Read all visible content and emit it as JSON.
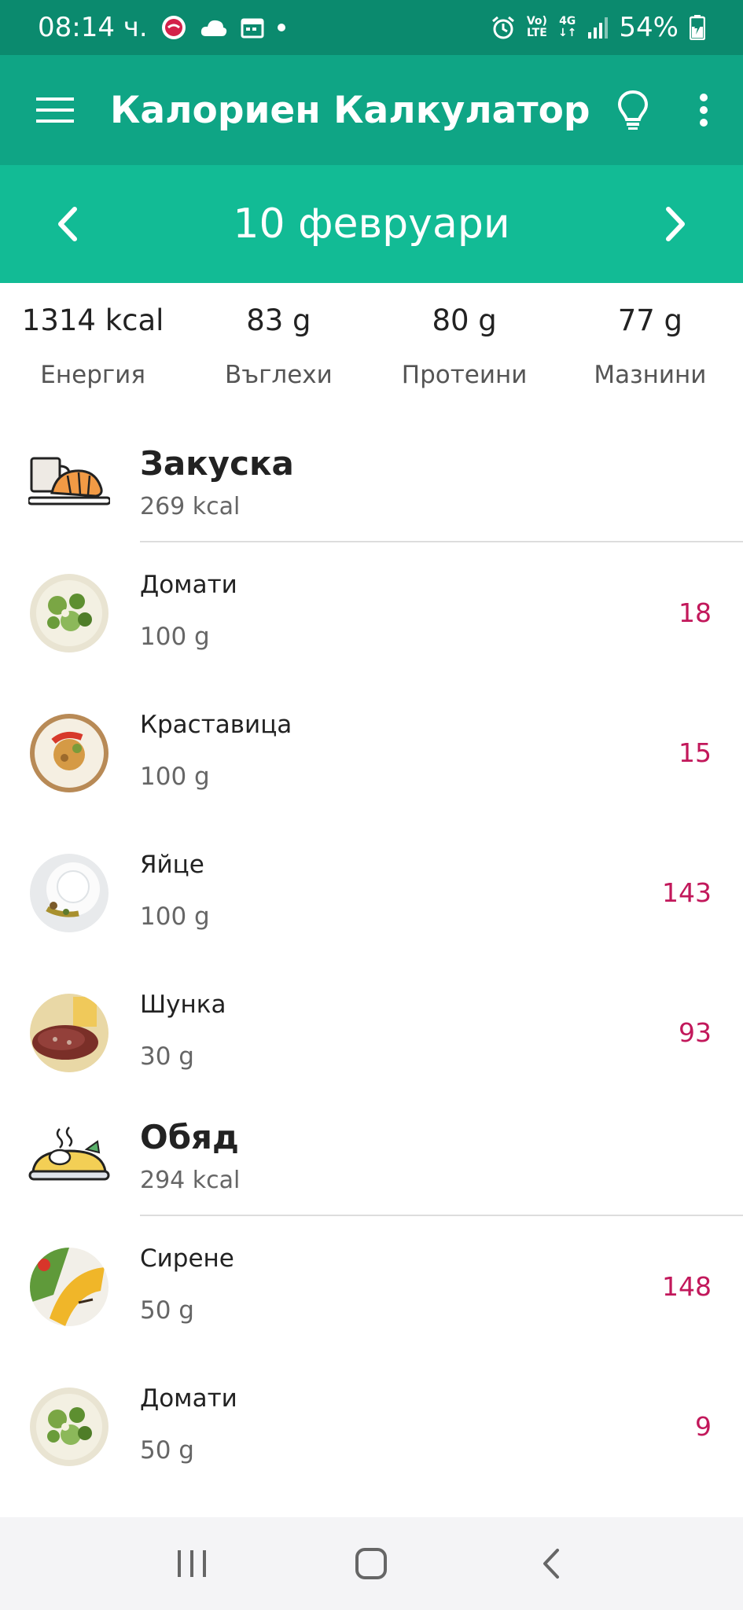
{
  "status_bar": {
    "time": "08:14 ч.",
    "volte_line1": "Vo)",
    "volte_line2": "LTE",
    "network": "4G",
    "battery": "54%"
  },
  "app_bar": {
    "title": "Калориен Калкулатор"
  },
  "date_bar": {
    "date": "10 февруари"
  },
  "summary": [
    {
      "value": "1314 kcal",
      "label": "Енергия"
    },
    {
      "value": "83 g",
      "label": "Въглехи"
    },
    {
      "value": "80 g",
      "label": "Протеини"
    },
    {
      "value": "77 g",
      "label": "Мазнини"
    }
  ],
  "meals": [
    {
      "name": "Закуска",
      "kcal": "269 kcal",
      "icon": "breakfast-icon",
      "items": [
        {
          "name": "Домати",
          "qty": "100 g",
          "kcal": "18",
          "thumb": "salad-thumb"
        },
        {
          "name": "Краставица",
          "qty": "100 g",
          "kcal": "15",
          "thumb": "plate-thumb"
        },
        {
          "name": "Яйце",
          "qty": "100 g",
          "kcal": "143",
          "thumb": "yogurt-thumb"
        },
        {
          "name": "Шунка",
          "qty": "30 g",
          "kcal": "93",
          "thumb": "meat-thumb"
        }
      ]
    },
    {
      "name": "Обяд",
      "kcal": "294 kcal",
      "icon": "lunch-icon",
      "items": [
        {
          "name": "Сирене",
          "qty": "50 g",
          "kcal": "148",
          "thumb": "omelette-thumb"
        },
        {
          "name": "Домати",
          "qty": "50 g",
          "kcal": "9",
          "thumb": "salad-thumb"
        }
      ]
    }
  ],
  "colors": {
    "status_bar": "#0b8a6e",
    "app_bar": "#0fa585",
    "date_bar": "#12bb95",
    "kcal_accent": "#c2185b"
  }
}
